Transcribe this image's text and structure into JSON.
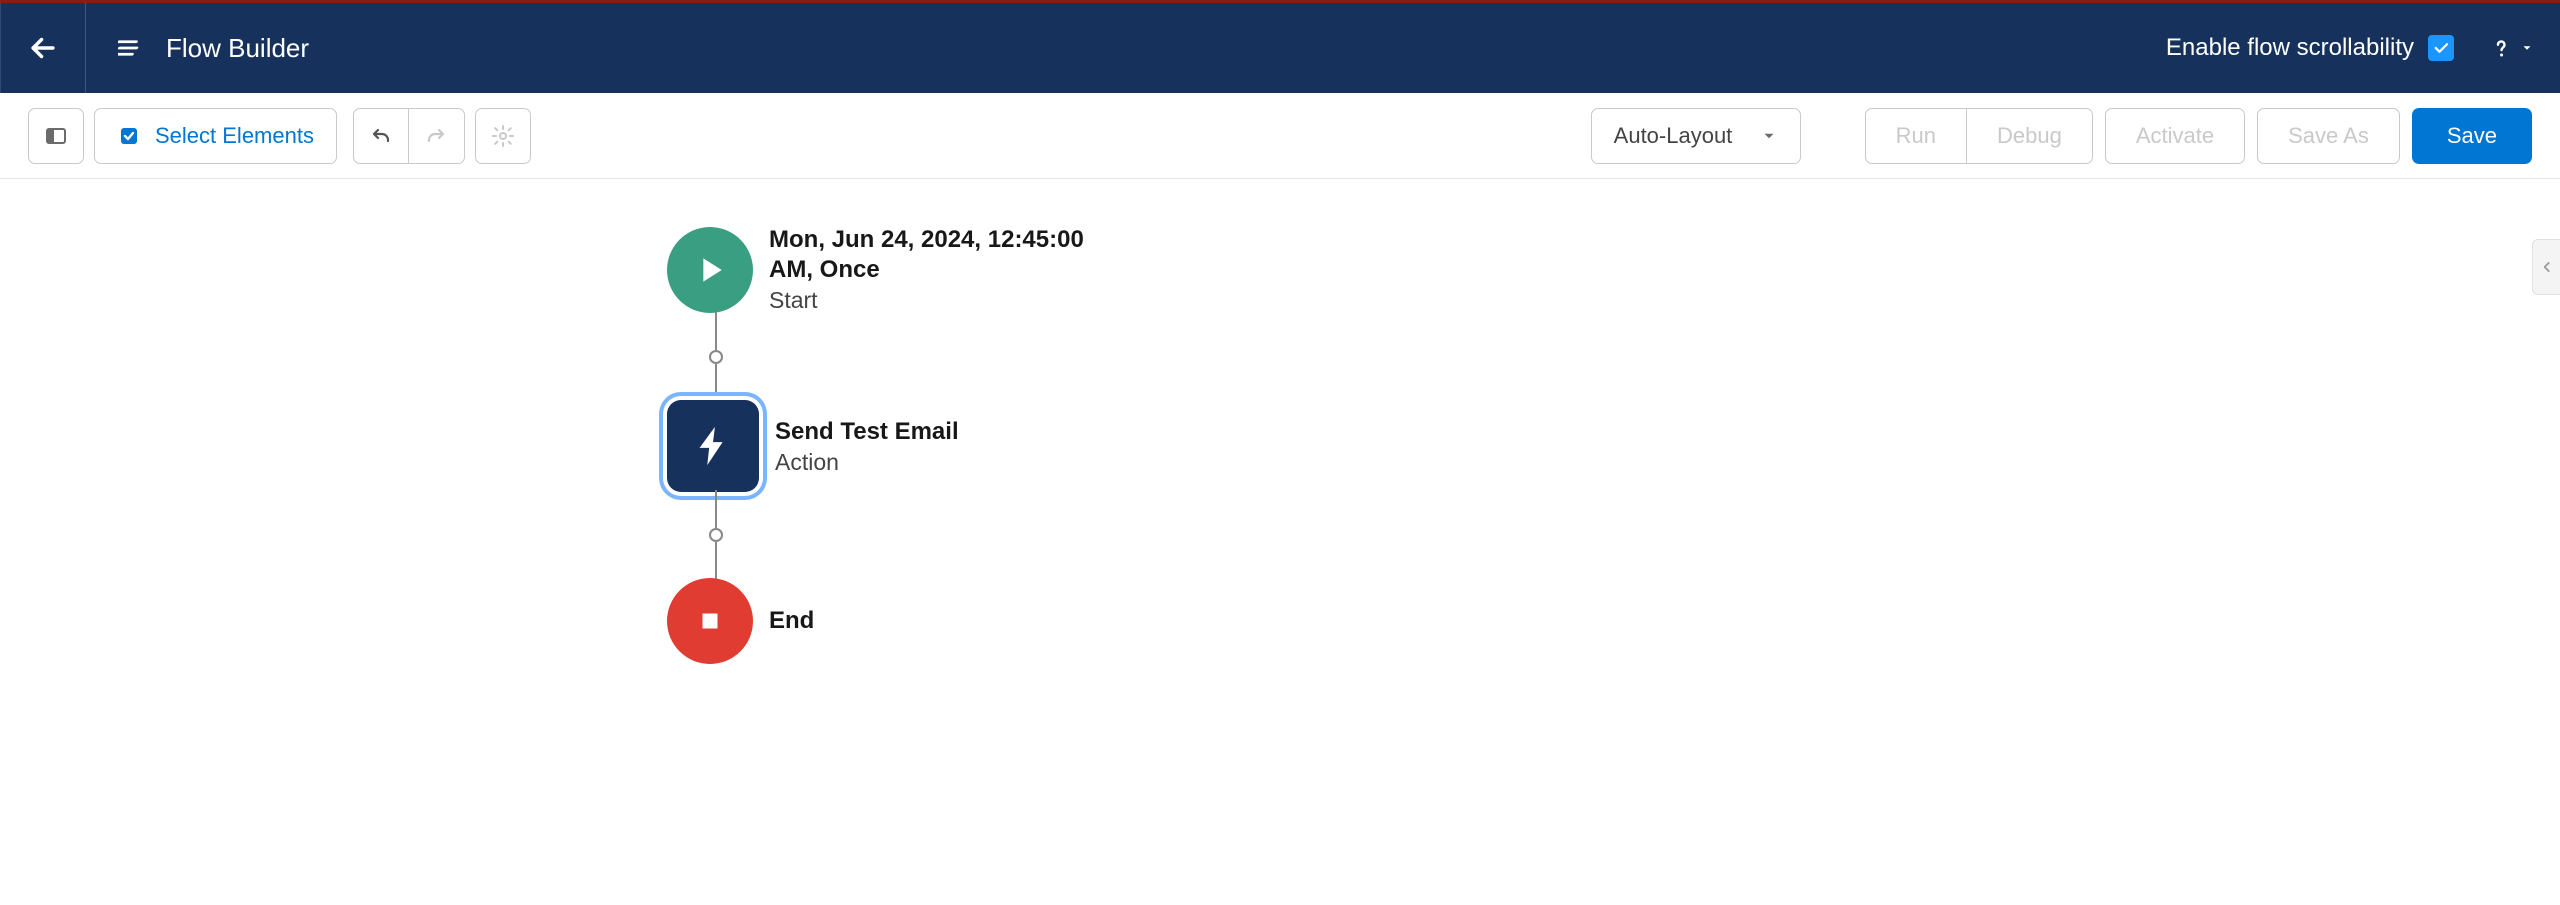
{
  "header": {
    "title": "Flow Builder",
    "scroll_label": "Enable flow scrollability",
    "scroll_checked": true
  },
  "toolbar": {
    "select_elements": "Select Elements",
    "layout_mode": "Auto-Layout",
    "run": "Run",
    "debug": "Debug",
    "activate": "Activate",
    "save_as": "Save As",
    "save": "Save"
  },
  "flow": {
    "start": {
      "title": "Mon, Jun 24, 2024, 12:45:00 AM, Once",
      "sub": "Start"
    },
    "action": {
      "title": "Send Test Email",
      "sub": "Action"
    },
    "end": {
      "title": "End"
    }
  }
}
